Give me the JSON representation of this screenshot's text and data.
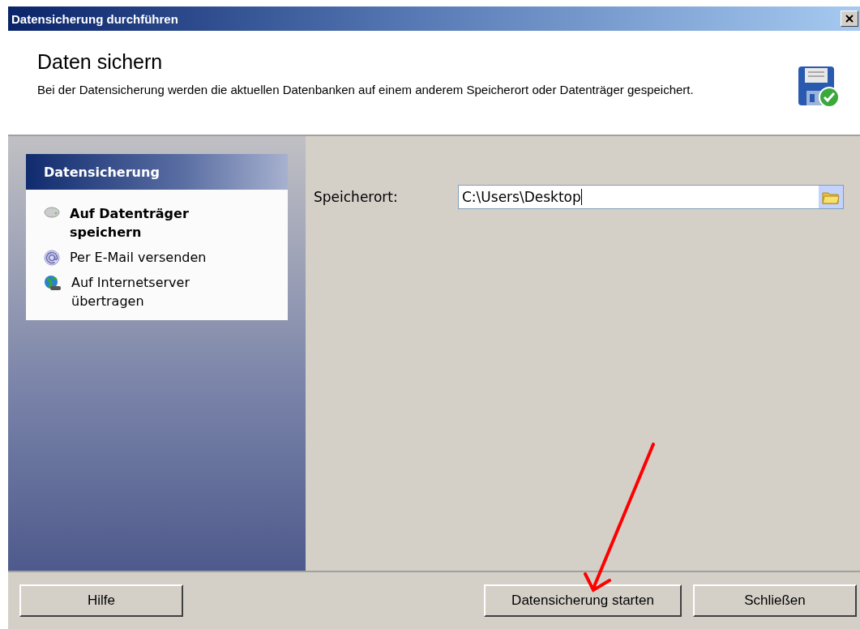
{
  "window": {
    "title": "Datensicherung durchführen"
  },
  "header": {
    "title": "Daten sichern",
    "description": "Bei der Datensicherung werden die aktuellen Datenbanken auf einem anderem Speicherort oder Datenträger gespeichert."
  },
  "sidebar": {
    "title": "Datensicherung",
    "items": [
      {
        "kind": "drive",
        "label": "Auf Datenträger speichern",
        "selected": true
      },
      {
        "kind": "email",
        "label": "Per E-Mail versenden",
        "selected": false
      },
      {
        "kind": "globe",
        "label": "Auf Internetserver übertragen",
        "selected": false
      }
    ]
  },
  "form": {
    "label": "Speicherort:",
    "value": "C:\\Users\\Desktop"
  },
  "buttons": {
    "help": "Hilfe",
    "start": "Datensicherung starten",
    "close": "Schließen"
  }
}
